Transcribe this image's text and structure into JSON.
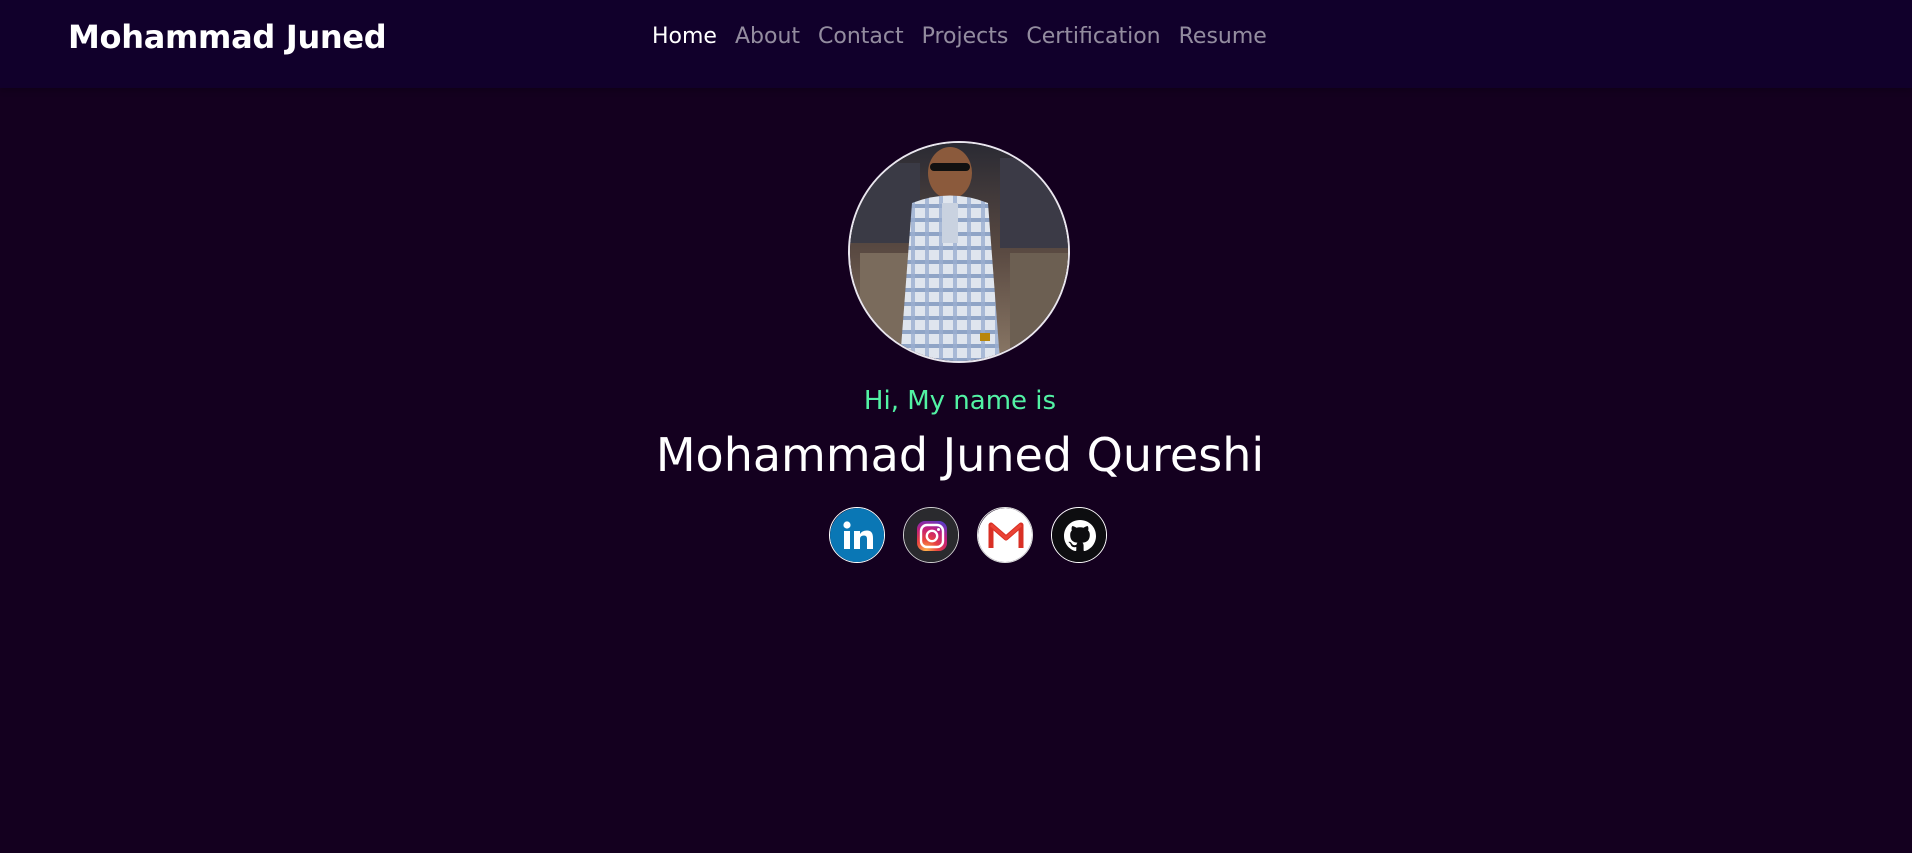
{
  "nav": {
    "brand": "Mohammad Juned",
    "links": [
      {
        "label": "Home",
        "active": true
      },
      {
        "label": "About",
        "active": false
      },
      {
        "label": "Contact",
        "active": false
      },
      {
        "label": "Projects",
        "active": false
      },
      {
        "label": "Certification",
        "active": false
      },
      {
        "label": "Resume",
        "active": false
      }
    ]
  },
  "hero": {
    "greeting": "Hi, My name is",
    "name": "Mohammad Juned Qureshi",
    "avatar_icon": "profile-photo"
  },
  "socials": [
    {
      "name": "linkedin",
      "icon": "linkedin-icon"
    },
    {
      "name": "instagram",
      "icon": "instagram-icon"
    },
    {
      "name": "gmail",
      "icon": "gmail-icon"
    },
    {
      "name": "github",
      "icon": "github-icon"
    }
  ],
  "colors": {
    "background": "#14001f",
    "navbar": "#11002b",
    "accent_green": "#52f2a4",
    "linkedin": "#0a66c2",
    "gmail_red": "#d93025"
  }
}
